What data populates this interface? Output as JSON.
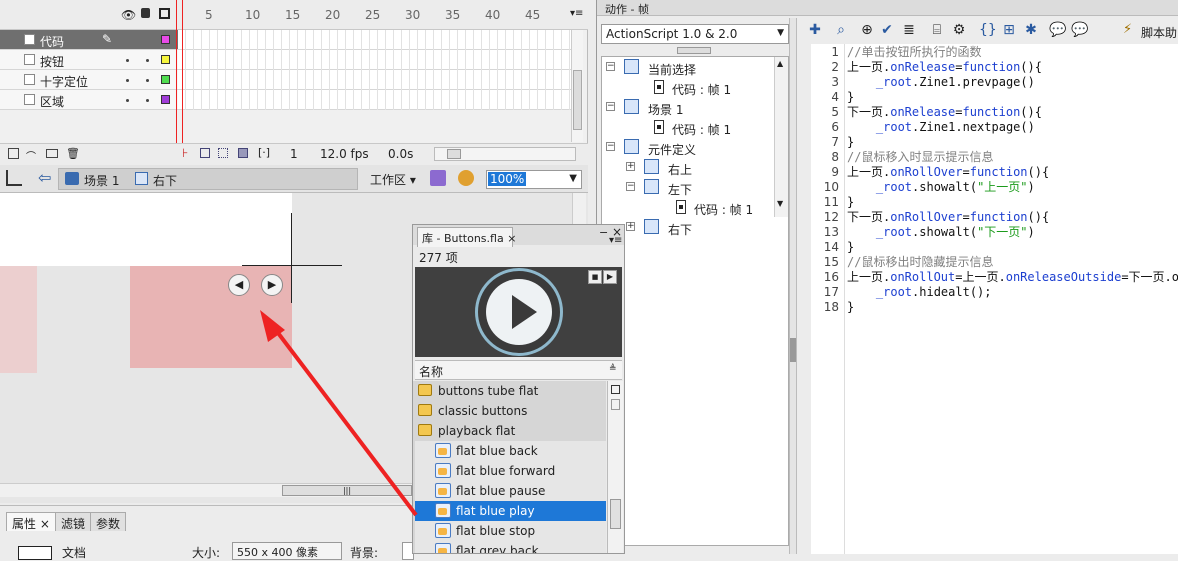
{
  "timeline": {
    "ruler": [
      "5",
      "10",
      "15",
      "20",
      "25",
      "30",
      "35",
      "40",
      "45"
    ],
    "layers": [
      {
        "name": "代码",
        "color": "#e84ae8",
        "selected": true
      },
      {
        "name": "按钮",
        "color": "#f5f53d",
        "selected": false
      },
      {
        "name": "十字定位",
        "color": "#4fdc4f",
        "selected": false
      },
      {
        "name": "区域",
        "color": "#a13dd8",
        "selected": false
      }
    ],
    "status": {
      "frame": "1",
      "fps": "12.0 fps",
      "time": "0.0s"
    }
  },
  "editbar": {
    "scene": "场景 1",
    "symbol": "右下",
    "workspace": "工作区",
    "zoom": "100%"
  },
  "properties": {
    "tabs": [
      "属性",
      "滤镜",
      "参数"
    ],
    "doc_label": "文档",
    "size_label": "大小:",
    "size_value": "550 x 400 像素",
    "bg_label": "背景:"
  },
  "library": {
    "title": "库 - Buttons.fla",
    "count": "277 项",
    "column": "名称",
    "items": [
      {
        "name": "buttons tube flat",
        "type": "folder",
        "selected": false
      },
      {
        "name": "classic buttons",
        "type": "folder",
        "selected": false
      },
      {
        "name": "playback flat",
        "type": "folder-open",
        "selected": false
      },
      {
        "name": "flat blue back",
        "type": "button",
        "selected": false
      },
      {
        "name": "flat blue forward",
        "type": "button",
        "selected": false
      },
      {
        "name": "flat blue pause",
        "type": "button",
        "selected": false
      },
      {
        "name": "flat blue play",
        "type": "button",
        "selected": true
      },
      {
        "name": "flat blue stop",
        "type": "button",
        "selected": false
      },
      {
        "name": "flat grey back",
        "type": "button",
        "selected": false
      }
    ]
  },
  "actions": {
    "title": "动作 - 帧",
    "language": "ActionScript 1.0 & 2.0",
    "script_assist": "脚本助",
    "tree": [
      {
        "label": "当前选择",
        "level": 0,
        "icon": "selection"
      },
      {
        "label": "代码 : 帧 1",
        "level": 1,
        "icon": "doc"
      },
      {
        "label": "场景 1",
        "level": 0,
        "icon": "scene"
      },
      {
        "label": "代码 : 帧 1",
        "level": 1,
        "icon": "doc"
      },
      {
        "label": "元件定义",
        "level": 0,
        "icon": "symbols"
      },
      {
        "label": "右上",
        "level": 1,
        "icon": "button"
      },
      {
        "label": "左下",
        "level": 1,
        "icon": "button"
      },
      {
        "label": "代码 : 帧 1",
        "level": 2,
        "icon": "doc"
      },
      {
        "label": "右下",
        "level": 1,
        "icon": "button"
      }
    ],
    "code": [
      [
        {
          "t": "//单击按钮所执行的函数",
          "c": "#808080"
        }
      ],
      [
        {
          "t": "上一页.",
          "c": "#111"
        },
        {
          "t": "onRelease",
          "c": "#1c3fd0"
        },
        {
          "t": "=",
          "c": "#111"
        },
        {
          "t": "function",
          "c": "#1c3fd0"
        },
        {
          "t": "(){",
          "c": "#111"
        }
      ],
      [
        {
          "t": "    ",
          "c": "#111"
        },
        {
          "t": "_root",
          "c": "#1c3fd0"
        },
        {
          "t": ".Zine1.prevpage()",
          "c": "#111"
        }
      ],
      [
        {
          "t": "}",
          "c": "#111"
        }
      ],
      [
        {
          "t": "下一页.",
          "c": "#111"
        },
        {
          "t": "onRelease",
          "c": "#1c3fd0"
        },
        {
          "t": "=",
          "c": "#111"
        },
        {
          "t": "function",
          "c": "#1c3fd0"
        },
        {
          "t": "(){",
          "c": "#111"
        }
      ],
      [
        {
          "t": "    ",
          "c": "#111"
        },
        {
          "t": "_root",
          "c": "#1c3fd0"
        },
        {
          "t": ".Zine1.nextpage()",
          "c": "#111"
        }
      ],
      [
        {
          "t": "}",
          "c": "#111"
        }
      ],
      [
        {
          "t": "//鼠标移入时显示提示信息",
          "c": "#808080"
        }
      ],
      [
        {
          "t": "上一页.",
          "c": "#111"
        },
        {
          "t": "onRollOver",
          "c": "#1c3fd0"
        },
        {
          "t": "=",
          "c": "#111"
        },
        {
          "t": "function",
          "c": "#1c3fd0"
        },
        {
          "t": "(){",
          "c": "#111"
        }
      ],
      [
        {
          "t": "    ",
          "c": "#111"
        },
        {
          "t": "_root",
          "c": "#1c3fd0"
        },
        {
          "t": ".showalt(",
          "c": "#111"
        },
        {
          "t": "\"上一页\"",
          "c": "#1a9a1a"
        },
        {
          "t": ")",
          "c": "#111"
        }
      ],
      [
        {
          "t": "}",
          "c": "#111"
        }
      ],
      [
        {
          "t": "下一页.",
          "c": "#111"
        },
        {
          "t": "onRollOver",
          "c": "#1c3fd0"
        },
        {
          "t": "=",
          "c": "#111"
        },
        {
          "t": "function",
          "c": "#1c3fd0"
        },
        {
          "t": "(){",
          "c": "#111"
        }
      ],
      [
        {
          "t": "    ",
          "c": "#111"
        },
        {
          "t": "_root",
          "c": "#1c3fd0"
        },
        {
          "t": ".showalt(",
          "c": "#111"
        },
        {
          "t": "\"下一页\"",
          "c": "#1a9a1a"
        },
        {
          "t": ")",
          "c": "#111"
        }
      ],
      [
        {
          "t": "}",
          "c": "#111"
        }
      ],
      [
        {
          "t": "//鼠标移出时隐藏提示信息",
          "c": "#808080"
        }
      ],
      [
        {
          "t": "上一页.",
          "c": "#111"
        },
        {
          "t": "onRollOut",
          "c": "#1c3fd0"
        },
        {
          "t": "=上一页.",
          "c": "#111"
        },
        {
          "t": "onReleaseOutside",
          "c": "#1c3fd0"
        },
        {
          "t": "=下一页.o",
          "c": "#111"
        }
      ],
      [
        {
          "t": "    ",
          "c": "#111"
        },
        {
          "t": "_root",
          "c": "#1c3fd0"
        },
        {
          "t": ".hidealt();",
          "c": "#111"
        }
      ],
      [
        {
          "t": "}",
          "c": "#111"
        }
      ]
    ]
  },
  "colors": {
    "selection": "#1e78d7",
    "annotation_arrow": "#ee2222",
    "stage_pink": "#e8b4b4"
  }
}
